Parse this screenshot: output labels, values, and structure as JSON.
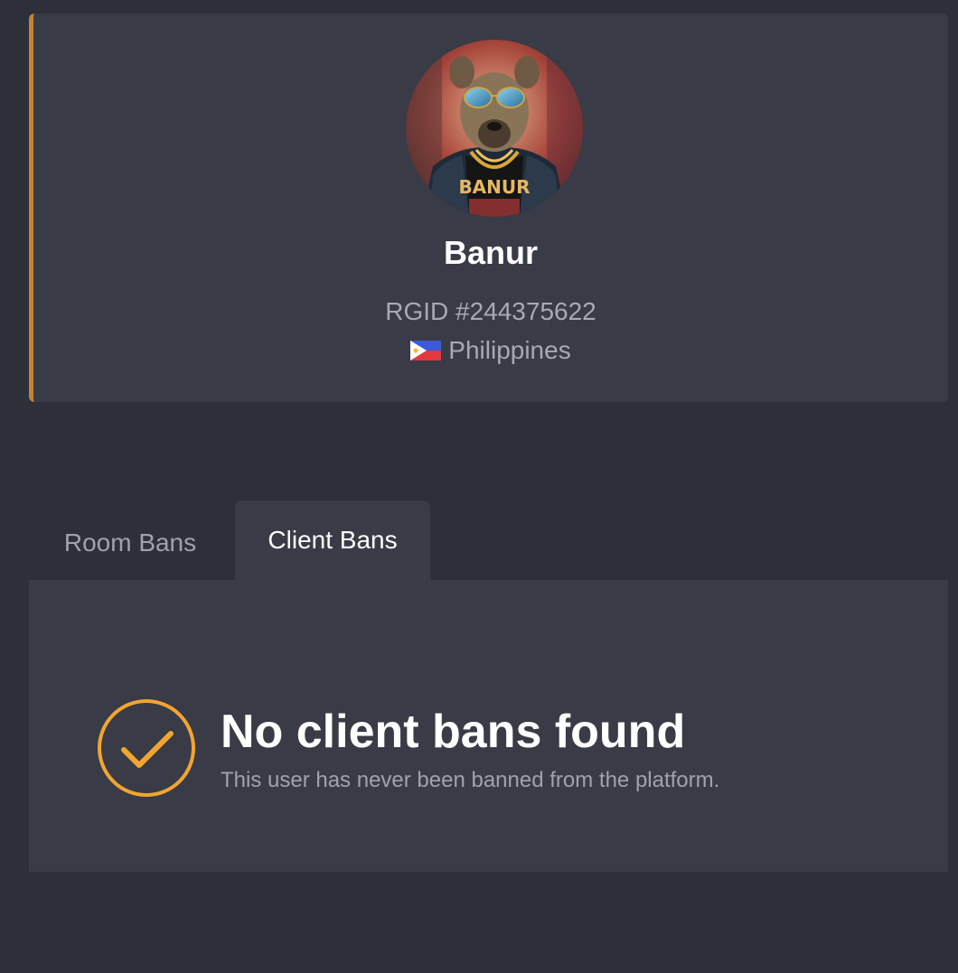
{
  "profile": {
    "username": "Banur",
    "rgid": "RGID #244375622",
    "country": "Philippines",
    "flag_icon": "philippines-flag-icon",
    "avatar_shirt_text": "BANUR",
    "accent_color": "#c2852f"
  },
  "tabs": [
    {
      "label": "Room Bans",
      "active": false
    },
    {
      "label": "Client Bans",
      "active": true
    }
  ],
  "empty_state": {
    "icon": "check-circle-icon",
    "title": "No client bans found",
    "subtitle": "This user has never been banned from the platform.",
    "icon_color": "#f2a531"
  }
}
